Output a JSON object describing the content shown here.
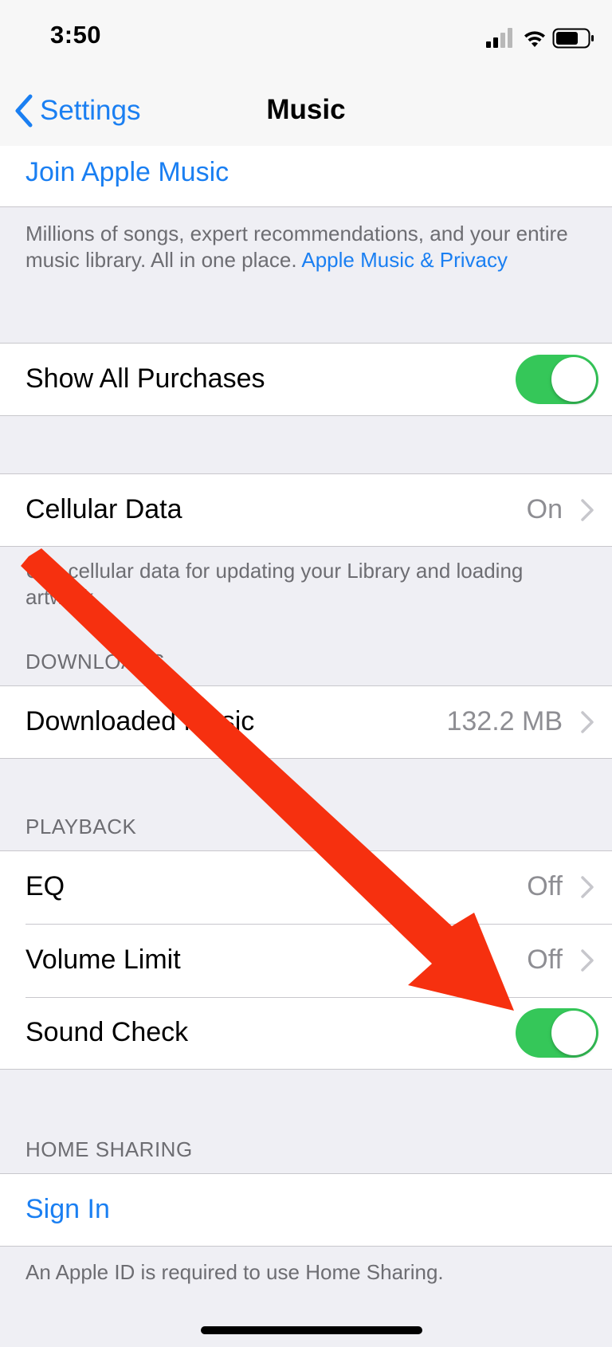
{
  "status": {
    "time": "3:50"
  },
  "nav": {
    "back_label": "Settings",
    "title": "Music"
  },
  "join": {
    "label": "Join Apple Music"
  },
  "join_footer": {
    "text": "Millions of songs, expert recommendations, and your entire music library. All in one place.",
    "link": "Apple Music & Privacy"
  },
  "show_all_purchases": {
    "label": "Show All Purchases",
    "on": true
  },
  "cellular": {
    "label": "Cellular Data",
    "value": "On",
    "footer": "Use cellular data for updating your Library and loading artwork."
  },
  "downloads": {
    "header": "DOWNLOADS",
    "label": "Downloaded Music",
    "value": "132.2 MB"
  },
  "playback": {
    "header": "PLAYBACK",
    "eq_label": "EQ",
    "eq_value": "Off",
    "volume_label": "Volume Limit",
    "volume_value": "Off",
    "sound_check_label": "Sound Check",
    "sound_check_on": true
  },
  "home_sharing": {
    "header": "HOME SHARING",
    "sign_in": "Sign In",
    "footer": "An Apple ID is required to use Home Sharing."
  },
  "colors": {
    "accent": "#1a7ff2",
    "toggle_on": "#35c759",
    "annotation_arrow": "#f6300f"
  }
}
